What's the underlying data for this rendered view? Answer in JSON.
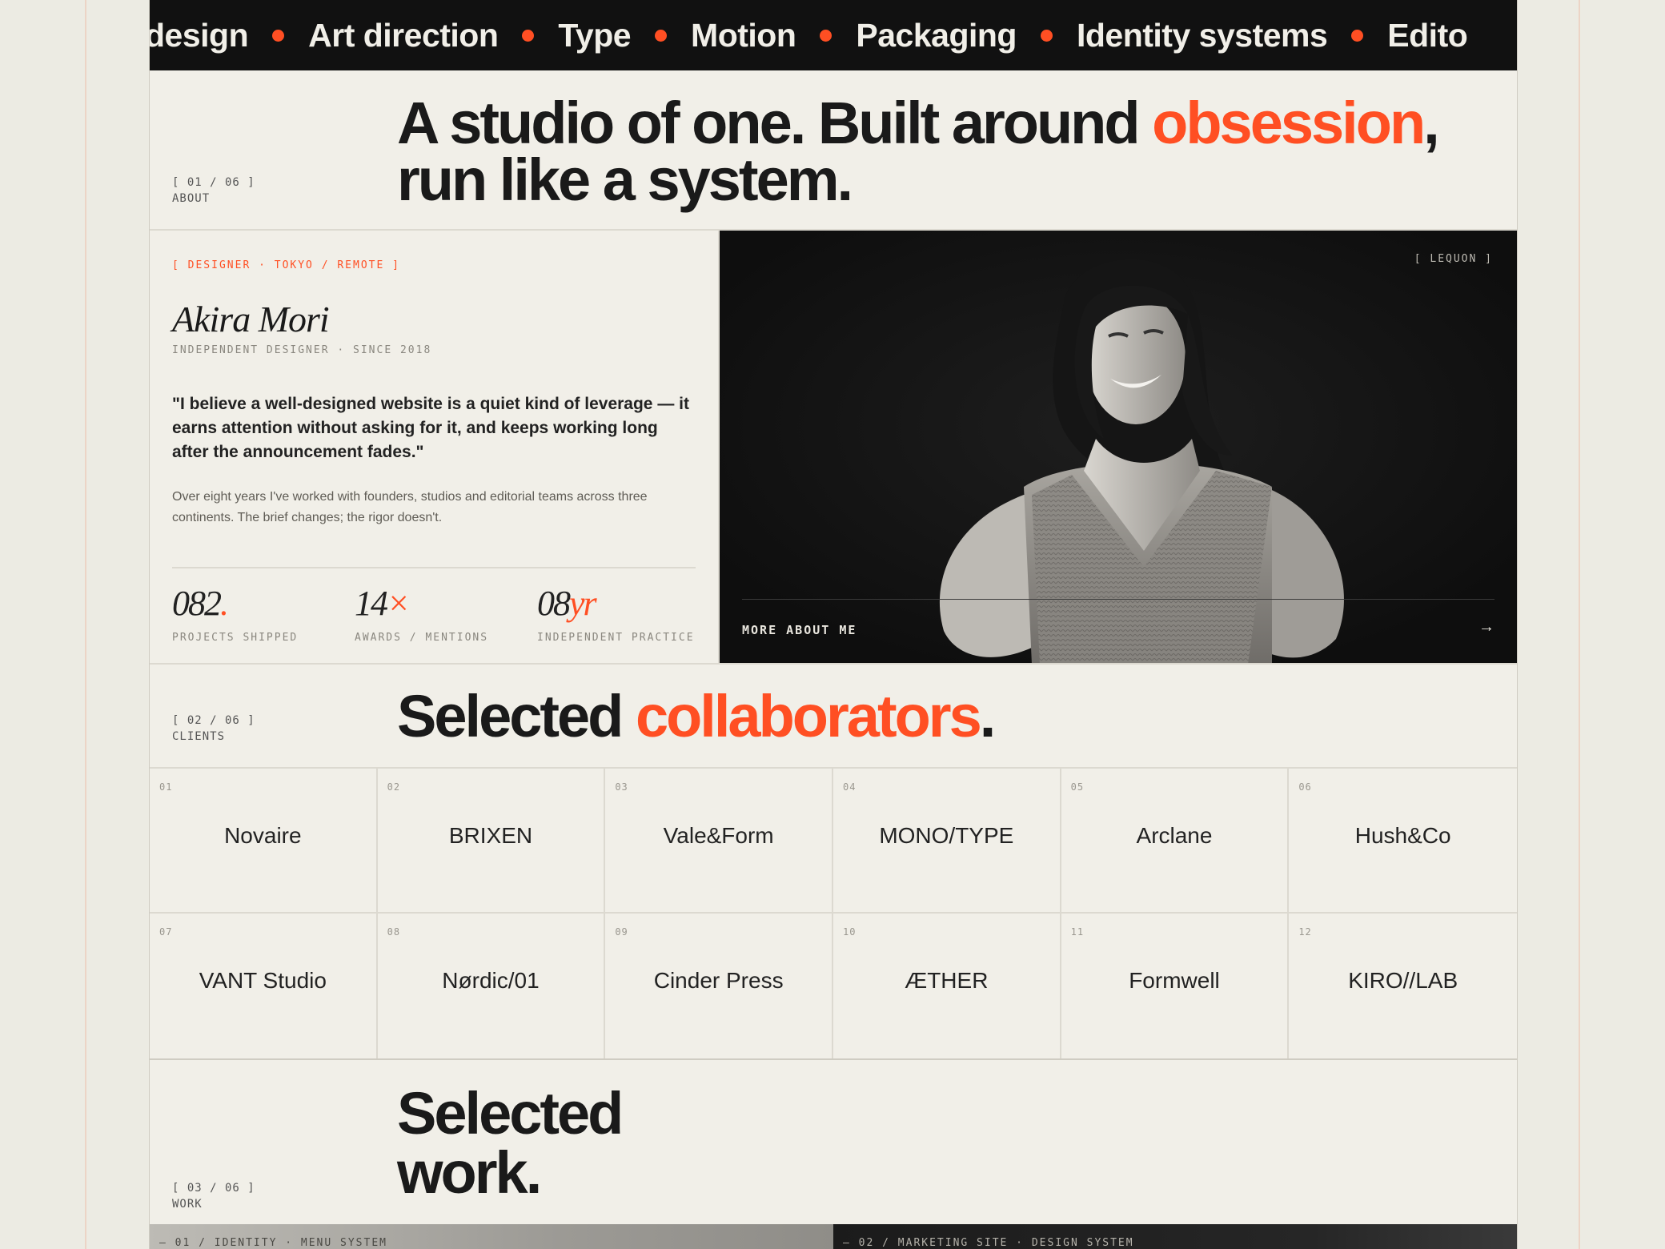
{
  "marquee": {
    "items": [
      "design",
      "Art direction",
      "Type",
      "Motion",
      "Packaging",
      "Identity systems",
      "Edito"
    ]
  },
  "about": {
    "index": "[ 01 / 06 ]",
    "label": "ABOUT",
    "headline": {
      "part1": "A studio of one. Built around ",
      "accent": "obsession",
      "part2": ",",
      "line2": "run like a system."
    }
  },
  "profile": {
    "tagline": "[ DESIGNER · TOKYO / REMOTE ]",
    "name": "Akira Mori",
    "role": "INDEPENDENT DESIGNER · SINCE 2018",
    "quote": "\"I believe a well-designed website is a quiet kind of leverage — it earns attention without asking for it, and keeps working long after the announcement fades.\"",
    "bio": "Over eight years I've worked with founders, studios and editorial teams across three continents. The brief changes; the rigor doesn't.",
    "stats": [
      {
        "num": "082",
        "suffix": ".",
        "label": "PROJECTS SHIPPED"
      },
      {
        "num": "14",
        "suffix": "×",
        "label": "AWARDS / MENTIONS"
      },
      {
        "num": "08",
        "suffix": "yr",
        "label": "INDEPENDENT PRACTICE"
      }
    ],
    "photo_label": "[ LEQUON ]",
    "more_link": "MORE ABOUT ME",
    "more_arrow": "→"
  },
  "clients": {
    "index": "[ 02 / 06 ]",
    "label": "CLIENTS",
    "title": {
      "part1": "Selected ",
      "accent": "collaborators",
      "part2": "."
    },
    "items": [
      {
        "idx": "01",
        "name": "Novaire"
      },
      {
        "idx": "02",
        "name": "BRIXEN"
      },
      {
        "idx": "03",
        "name": "Vale&Form"
      },
      {
        "idx": "04",
        "name": "MONO/TYPE"
      },
      {
        "idx": "05",
        "name": "Arclane"
      },
      {
        "idx": "06",
        "name": "Hush&Co"
      },
      {
        "idx": "07",
        "name": "VANT Studio"
      },
      {
        "idx": "08",
        "name": "Nørdic/01"
      },
      {
        "idx": "09",
        "name": "Cinder Press"
      },
      {
        "idx": "10",
        "name": "ÆTHER"
      },
      {
        "idx": "11",
        "name": "Formwell"
      },
      {
        "idx": "12",
        "name": "KIRO//LAB"
      }
    ]
  },
  "work": {
    "index": "[ 03 / 06 ]",
    "label": "WORK",
    "title_line1": "Selected",
    "title_line2": "work.",
    "cards": [
      {
        "label": "— 01 / IDENTITY · MENU SYSTEM"
      },
      {
        "label": "— 02 / MARKETING SITE · DESIGN SYSTEM"
      }
    ]
  },
  "colors": {
    "accent": "#ff4f23",
    "ink": "#1a1a1a",
    "paper": "#f1efe8",
    "dark": "#111111"
  }
}
